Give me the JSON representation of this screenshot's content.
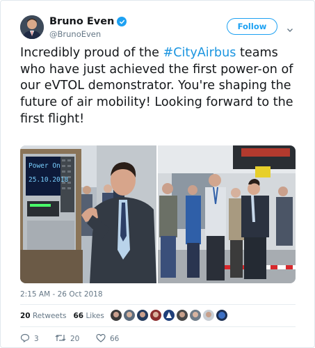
{
  "author": {
    "name": "Bruno Even",
    "handle": "@BrunoEven",
    "verified": true
  },
  "follow_button": {
    "label": "Follow"
  },
  "tweet": {
    "text_before": "Incredibly proud of the ",
    "hashtag": "#CityAirbus",
    "text_after": " teams who have just achieved the first power-on of our eVTOL demonstrator. You're shaping the future of air mobility! Looking forward to the first flight!"
  },
  "media": {
    "left_screen_line1": "Power On",
    "left_screen_line2": "25.10.2018"
  },
  "timestamp": "2:15 AM - 26 Oct 2018",
  "stats": {
    "retweets_count": "20",
    "retweets_label": "Retweets",
    "likes_count": "66",
    "likes_label": "Likes"
  },
  "actions": {
    "replies": "3",
    "retweets": "20",
    "likes": "66"
  },
  "colors": {
    "accent": "#1da1f2",
    "hashtag": "#1b95e0",
    "text": "#14171a",
    "secondary": "#657786"
  },
  "icons": [
    "verified-badge-icon",
    "chevron-down-icon",
    "reply-icon",
    "retweet-icon",
    "heart-icon"
  ]
}
